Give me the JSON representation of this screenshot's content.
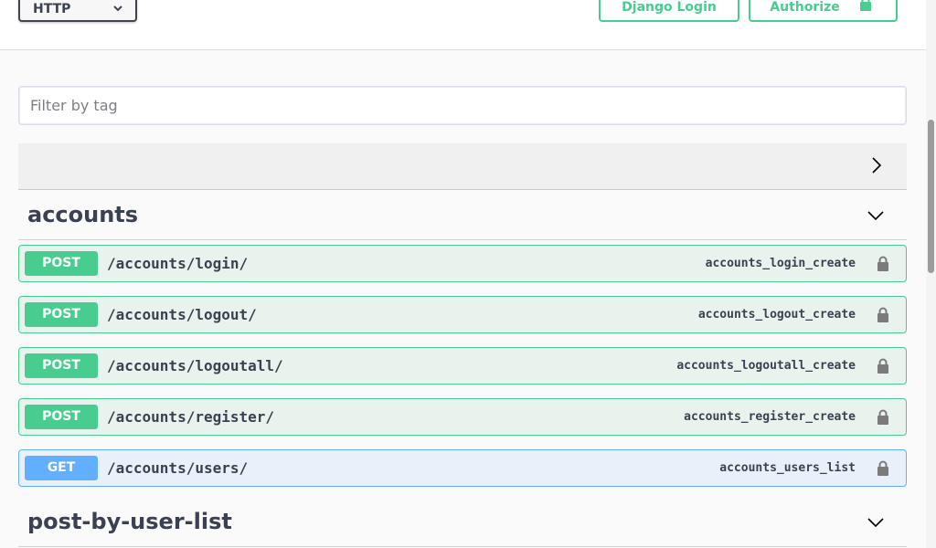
{
  "header": {
    "scheme_select": {
      "selected": "HTTP"
    },
    "django_login_label": "Django Login",
    "authorize_label": "Authorize"
  },
  "filter": {
    "placeholder": "Filter by tag",
    "value": ""
  },
  "sections": [
    {
      "title": "accounts",
      "operations": [
        {
          "method": "POST",
          "path": "/accounts/login/",
          "operation_id": "accounts_login_create"
        },
        {
          "method": "POST",
          "path": "/accounts/logout/",
          "operation_id": "accounts_logout_create"
        },
        {
          "method": "POST",
          "path": "/accounts/logoutall/",
          "operation_id": "accounts_logoutall_create"
        },
        {
          "method": "POST",
          "path": "/accounts/register/",
          "operation_id": "accounts_register_create"
        },
        {
          "method": "GET",
          "path": "/accounts/users/",
          "operation_id": "accounts_users_list"
        }
      ]
    },
    {
      "title": "post-by-user-list",
      "operations": []
    }
  ],
  "icons": {
    "scheme_select": "chevron-down-icon",
    "authorize": "lock-icon",
    "collapsed_section": "chevron-right-icon",
    "tag_toggle": "chevron-down-icon",
    "operation_lock": "lock-icon"
  },
  "colors": {
    "post": "#49cc90",
    "get": "#61affe",
    "post_bg": "#e8f3ed",
    "get_bg": "#e8f1fa",
    "text": "#3b4151"
  }
}
